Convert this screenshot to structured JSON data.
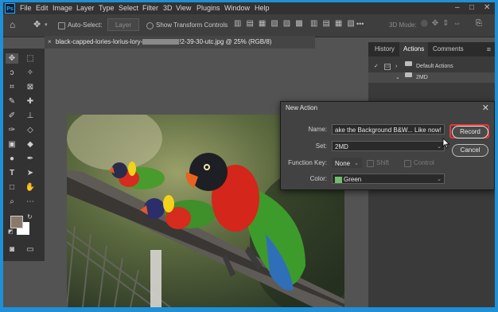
{
  "app": {
    "logo_text": "Ps"
  },
  "menu": [
    "File",
    "Edit",
    "Image",
    "Layer",
    "Type",
    "Select",
    "Filter",
    "3D",
    "View",
    "Plugins",
    "Window",
    "Help"
  ],
  "options_bar": {
    "auto_select_label": "Auto-Select:",
    "layer_select": "Layer",
    "show_transform_label": "Show Transform Controls",
    "mode_3d_label": "3D Mode:"
  },
  "document_tab": {
    "name_start": "black-capped-lories-lorius-lory-",
    "name_end": "!2-39-30-utc.jpg @ 25% (RGB/8)"
  },
  "panel": {
    "tabs": [
      "History",
      "Actions",
      "Comments"
    ],
    "active_tab": "Actions",
    "rows": [
      {
        "label": "Default Actions",
        "checked": true
      },
      {
        "label": "2MD",
        "checked": false
      }
    ]
  },
  "dialog": {
    "title": "New Action",
    "name_label": "Name:",
    "name_value": "ake the Background B&W... Like now!",
    "set_label": "Set:",
    "set_value": "2MD",
    "function_key_label": "Function Key:",
    "function_key_value": "None",
    "shift_label": "Shift",
    "control_label": "Control",
    "color_label": "Color:",
    "color_value": "Green",
    "record_label": "Record",
    "cancel_label": "Cancel"
  },
  "colors": {
    "accent": "#e53935",
    "frame": "#1f8fd6",
    "swatch_green": "#6fbf6a",
    "foreground": "#8a7a6a",
    "background": "#ffffff"
  }
}
